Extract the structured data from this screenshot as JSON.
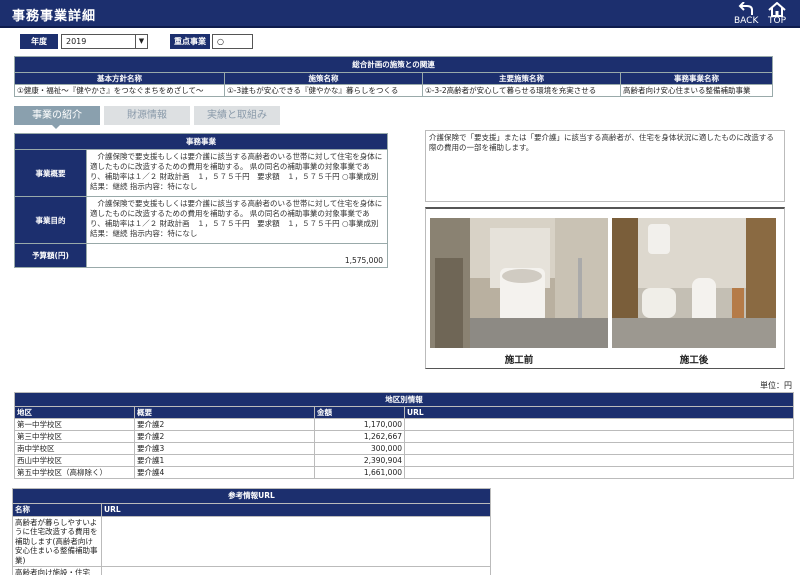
{
  "header": {
    "title": "事務事業詳細",
    "back_label": "BACK",
    "top_label": "TOP"
  },
  "filters": {
    "year_label": "年度",
    "year_value": "2019",
    "priority_label": "重点事業",
    "priority_value": "○"
  },
  "plan_table": {
    "caption": "総合計画の施策との関連",
    "headers": [
      "基本方針名称",
      "施策名称",
      "主要施策名称",
      "事務事業名称"
    ],
    "row": [
      "①健康・福祉～『健やかさ』をつなぐまちをめざして～",
      "①-3誰もが安心できる『健やかな』暮らしをつくる",
      "①-3-2高齢者が安心して暮らせる環境を充実させる",
      "高齢者向け安心住まいる整備補助事業"
    ]
  },
  "tabs": [
    "事業の紹介",
    "財源情報",
    "実績と取組み"
  ],
  "business": {
    "caption": "事務事業",
    "rows": [
      {
        "label": "事業概要",
        "text": "　介護保険で要支援もしくは要介護に該当する高齢者のいる世帯に対して住宅を身体に適したものに改造するための費用を補助する。 県の同名の補助事業の対象事業であり、補助率は１／２ 財政計画　１，５７５千円　要求額　１，５７５千円 ○事業成別結果：継続 指示内容：特になし"
      },
      {
        "label": "事業目的",
        "text": "　介護保険で要支援もしくは要介護に該当する高齢者のいる世帯に対して住宅を身体に適したものに改造するための費用を補助する。 県の同名の補助事業の対象事業であり、補助率は１／２ 財政計画　１，５７５千円　要求額　１，５７５千円 ○事業成別結果：継続 指示内容：特になし"
      },
      {
        "label": "予算額(円)",
        "text": "1,575,000"
      }
    ]
  },
  "description": "介護保険で「要支援」または「要介護」に該当する高齢者が、住宅を身体状況に適したものに改造する際の費用の一部を補助します。",
  "photos": {
    "before": "施工前",
    "after": "施工後"
  },
  "unit_label": "単位：円",
  "region_table": {
    "caption": "地区別情報",
    "headers": [
      "地区",
      "概要",
      "金額",
      "URL"
    ],
    "rows": [
      [
        "第一中学校区",
        "要介護2",
        "1,170,000",
        ""
      ],
      [
        "第三中学校区",
        "要介護2",
        "1,262,667",
        ""
      ],
      [
        "南中学校区",
        "要介護3",
        "300,000",
        ""
      ],
      [
        "西山中学校区",
        "要介護1",
        "2,390,904",
        ""
      ],
      [
        "第五中学校区（高柳除く）",
        "要介護4",
        "1,661,000",
        ""
      ]
    ]
  },
  "ref_table": {
    "caption": "参考情報URL",
    "headers": [
      "名称",
      "URL"
    ],
    "rows": [
      [
        "高齢者が暮らしやすいように住宅改造する費用を補助します(高齢者向け安心住まいる整備補助事業)",
        ""
      ],
      [
        "高齢者向け施設・住宅",
        ""
      ]
    ]
  },
  "colors": {
    "header_bg": "#1c2f6e",
    "tab_active": "#8aa0ae",
    "tab_inactive": "#dde0e2"
  }
}
